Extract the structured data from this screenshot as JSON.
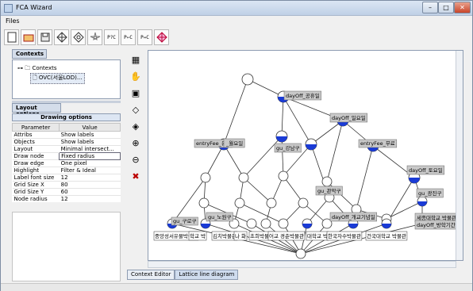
{
  "window": {
    "title": "FCA Wizard"
  },
  "menu": {
    "files": "Files"
  },
  "toolbar": {
    "buttons": [
      {
        "icon": "new-file-icon"
      },
      {
        "icon": "open-folder-icon"
      },
      {
        "icon": "save-icon"
      },
      {
        "icon": "lattice-icon"
      },
      {
        "icon": "lattice-outline-icon"
      },
      {
        "icon": "lattice-star-icon"
      },
      {
        "icon": "context-arrow-icon",
        "label": "P?C"
      },
      {
        "icon": "arrow-left-icon",
        "label": "P⇐C"
      },
      {
        "icon": "arrow-right-icon",
        "label": "P⇔C"
      },
      {
        "icon": "colored-lattice-icon"
      }
    ]
  },
  "contexts": {
    "tab": "Contexts",
    "root": "Contexts",
    "child": "OVC(서울LOD)..."
  },
  "layout": {
    "tab": "Layout options",
    "header": "Drawing options",
    "col_param": "Parameter",
    "col_value": "Value",
    "rows": [
      [
        "Attribs",
        "Show labels"
      ],
      [
        "Objects",
        "Show labels"
      ],
      [
        "Layout",
        "Minimal intersect..."
      ],
      [
        "Draw node",
        "Fixed radius"
      ],
      [
        "Draw edge",
        "One pixel"
      ],
      [
        "Highlight",
        "Filter & Ideal"
      ],
      [
        "Label font size",
        "12"
      ],
      [
        "Grid Size X",
        "80"
      ],
      [
        "Grid Size Y",
        "60"
      ],
      [
        "Node radius",
        "12"
      ]
    ]
  },
  "tabs": {
    "editor": "Context Editor",
    "lattice": "Lattice line diagram"
  },
  "diagram": {
    "attr_labels": [
      "dayOff_공휴일",
      "dayOff_일요일",
      "entryFee_유료",
      "_월요일",
      "gu_강남구",
      "entryFee_무료",
      "dayOff_토요일",
      "gu_관악구",
      "gu_광진구",
      "gu_구로구",
      "gu_노원구",
      "dayOff_개교기념일",
      "세종대학교 박물관",
      "dayOff_방학기간"
    ],
    "obj_labels": [
      "중앙성서유물박물관",
      "학교 박",
      "김치박물관",
      "나 화",
      "초희박물관",
      "어교 경춘박물관",
      "대학교 박",
      "한국자수박물관",
      "건국대학교 박물관"
    ]
  }
}
